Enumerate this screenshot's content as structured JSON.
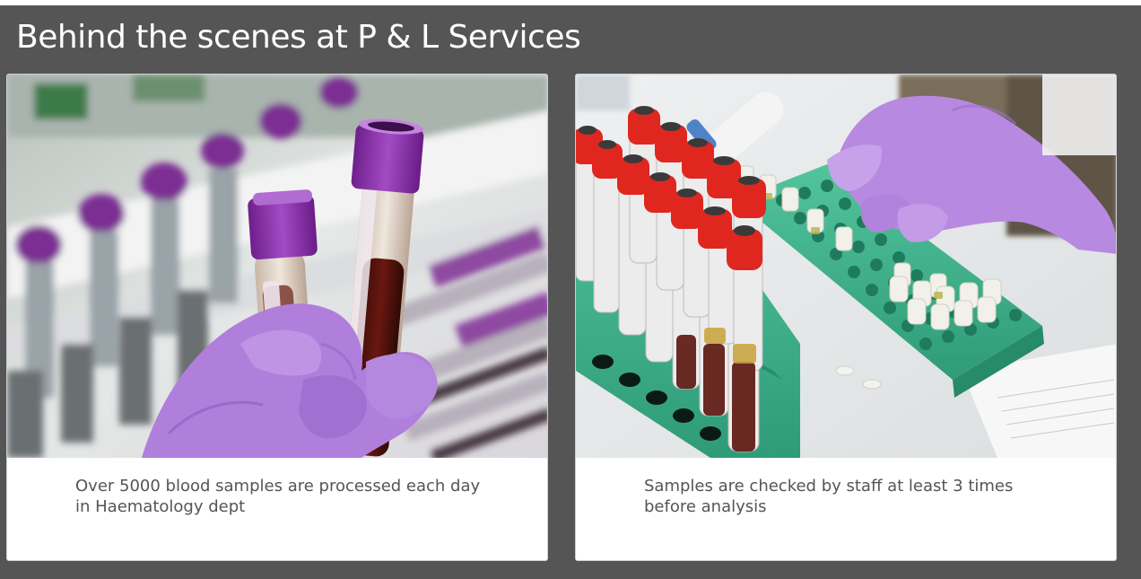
{
  "section": {
    "title": "Behind the scenes at P & L Services"
  },
  "cards": [
    {
      "image_alt": "Gloved hand holding two blood sample tubes with purple caps",
      "caption": "Over 5000 blood samples are processed each day in Haematology dept"
    },
    {
      "image_alt": "Gloved hands placing sample tubes into a green laboratory rack",
      "caption": "Samples are checked by staff at least 3 times before analysis"
    }
  ],
  "colors": {
    "panel_background": "#555555",
    "card_background": "#ffffff",
    "heading_text": "#ffffff",
    "caption_text": "#555555",
    "glove_purple": "#b07fdc",
    "cap_purple": "#8a2fa8",
    "cap_red": "#e0271f",
    "rack_green": "#3fae88"
  }
}
